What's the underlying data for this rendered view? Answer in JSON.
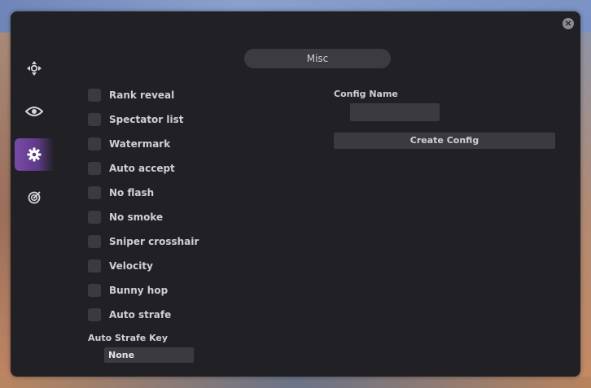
{
  "window": {
    "close_icon": "close-icon",
    "tab_title": "Misc"
  },
  "sidebar": {
    "items": [
      {
        "icon": "crosshair-arrows-icon",
        "active": false
      },
      {
        "icon": "eye-icon",
        "active": false
      },
      {
        "icon": "gear-icon",
        "active": true
      },
      {
        "icon": "target-icon",
        "active": false
      }
    ],
    "accent_color": "#7b4aa8"
  },
  "options": [
    {
      "label": "Rank reveal",
      "checked": false
    },
    {
      "label": "Spectator list",
      "checked": false
    },
    {
      "label": "Watermark",
      "checked": false
    },
    {
      "label": "Auto accept",
      "checked": false
    },
    {
      "label": "No flash",
      "checked": false
    },
    {
      "label": "No smoke",
      "checked": false
    },
    {
      "label": "Sniper crosshair",
      "checked": false
    },
    {
      "label": "Velocity",
      "checked": false
    },
    {
      "label": "Bunny hop",
      "checked": false
    },
    {
      "label": "Auto strafe",
      "checked": false
    }
  ],
  "auto_strafe_key": {
    "label": "Auto Strafe Key",
    "value": "None"
  },
  "config": {
    "label": "Config Name",
    "value": "",
    "placeholder": "",
    "create_label": "Create Config"
  }
}
